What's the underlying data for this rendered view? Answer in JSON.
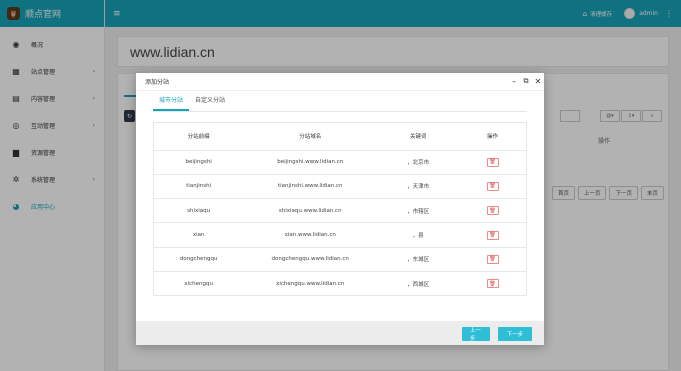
{
  "app": {
    "logo_text": "顺点官网",
    "logo_icon": "owl-logo"
  },
  "topbar": {
    "clear_cache": "清理缓存",
    "user": "admin"
  },
  "sidebar": {
    "items": [
      {
        "label": "概况",
        "icon": "dashboard-icon",
        "glyph": "◉",
        "arrow": ""
      },
      {
        "label": "站点管理",
        "icon": "grid-icon",
        "glyph": "▦",
        "arrow": "›"
      },
      {
        "label": "内容管理",
        "icon": "document-icon",
        "glyph": "▤",
        "arrow": "›"
      },
      {
        "label": "互动管理",
        "icon": "eye-icon",
        "glyph": "◎",
        "arrow": "›"
      },
      {
        "label": "资源管理",
        "icon": "file-icon",
        "glyph": "▆",
        "arrow": ""
      },
      {
        "label": "系统管理",
        "icon": "gear-icon",
        "glyph": "✲",
        "arrow": "›"
      },
      {
        "label": "应用中心",
        "icon": "globe-icon",
        "glyph": "◕",
        "arrow": ""
      }
    ]
  },
  "background": {
    "site_title": "www.lidian.cn",
    "col_header": "操作",
    "pager": [
      "首页",
      "上一页",
      "下一页",
      "末页"
    ]
  },
  "modal": {
    "title": "添加分站",
    "tabs": [
      "城市分站",
      "自定义分站"
    ],
    "columns": [
      "分站前缀",
      "分站域名",
      "关键词",
      "操作"
    ],
    "rows": [
      {
        "prefix": "beijingshi",
        "domain": "beijingshi.www.lidian.cn",
        "keyword": "，北京市"
      },
      {
        "prefix": "tianjinshi",
        "domain": "tianjinshi.www.lidian.cn",
        "keyword": "，天津市"
      },
      {
        "prefix": "shixiaqu",
        "domain": "shixiaqu.www.lidian.cn",
        "keyword": "，市辖区"
      },
      {
        "prefix": "xian",
        "domain": "xian.www.lidian.cn",
        "keyword": "，县"
      },
      {
        "prefix": "dongchengqu",
        "domain": "dongchengqu.www.lidian.cn",
        "keyword": "，东城区"
      },
      {
        "prefix": "xichengqu",
        "domain": "xichengqu.www.lidian.cn",
        "keyword": "，西城区"
      }
    ],
    "prev_button": "上一步",
    "next_button": "下一步"
  },
  "colors": {
    "accent": "#17a2b8",
    "button": "#2ebfd6",
    "danger": "#e04848"
  }
}
